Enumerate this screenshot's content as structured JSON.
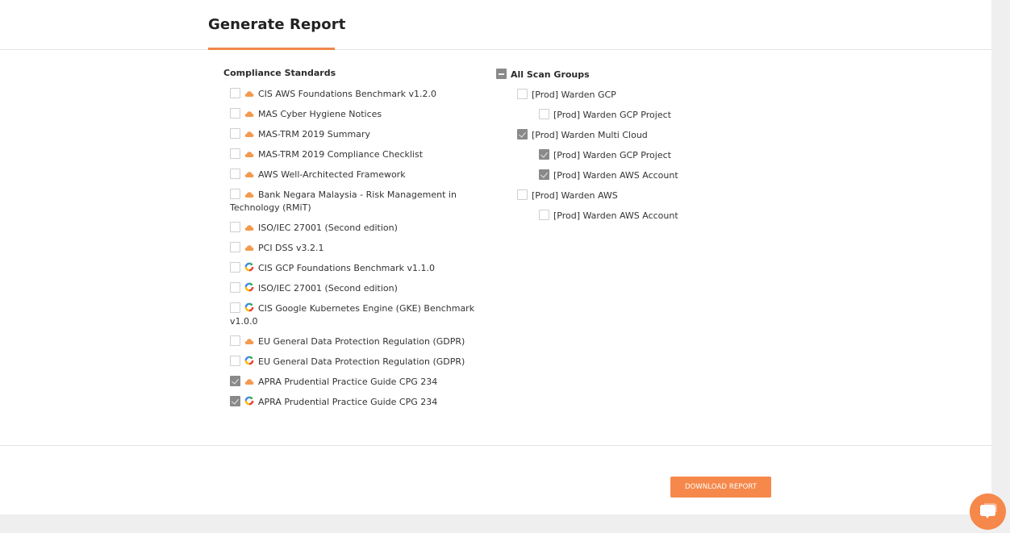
{
  "header": {
    "title": "Generate Report"
  },
  "compliance": {
    "section_title": "Compliance Standards",
    "items": [
      {
        "label": "CIS AWS Foundations Benchmark v1.2.0",
        "provider": "aws",
        "icon": "aws-cloud-icon",
        "checked": false
      },
      {
        "label": "MAS Cyber Hygiene Notices",
        "provider": "aws",
        "icon": "aws-cloud-icon",
        "checked": false
      },
      {
        "label": "MAS-TRM 2019 Summary",
        "provider": "aws",
        "icon": "aws-cloud-icon",
        "checked": false
      },
      {
        "label": "MAS-TRM 2019 Compliance Checklist",
        "provider": "aws",
        "icon": "aws-cloud-icon",
        "checked": false
      },
      {
        "label": "AWS Well-Architected Framework",
        "provider": "aws",
        "icon": "aws-cloud-icon",
        "checked": false
      },
      {
        "label": "Bank Negara Malaysia - Risk Management in Technology (RMiT)",
        "provider": "aws",
        "icon": "aws-cloud-icon",
        "checked": false
      },
      {
        "label": "ISO/IEC 27001 (Second edition)",
        "provider": "aws",
        "icon": "aws-cloud-icon",
        "checked": false
      },
      {
        "label": "PCI DSS v3.2.1",
        "provider": "aws",
        "icon": "aws-cloud-icon",
        "checked": false
      },
      {
        "label": "CIS GCP Foundations Benchmark v1.1.0",
        "provider": "gcp",
        "icon": "gcp-logo-icon",
        "checked": false
      },
      {
        "label": "ISO/IEC 27001 (Second edition)",
        "provider": "gcp",
        "icon": "gcp-logo-icon",
        "checked": false
      },
      {
        "label": "CIS Google Kubernetes Engine (GKE) Benchmark v1.0.0",
        "provider": "gcp",
        "icon": "gcp-logo-icon",
        "checked": false
      },
      {
        "label": "EU General Data Protection Regulation (GDPR)",
        "provider": "aws",
        "icon": "aws-cloud-icon",
        "checked": false
      },
      {
        "label": "EU General Data Protection Regulation (GDPR)",
        "provider": "gcp",
        "icon": "gcp-logo-icon",
        "checked": false
      },
      {
        "label": "APRA Prudential Practice Guide CPG 234",
        "provider": "aws",
        "icon": "aws-cloud-icon",
        "checked": true
      },
      {
        "label": "APRA Prudential Practice Guide CPG 234",
        "provider": "gcp",
        "icon": "gcp-logo-icon",
        "checked": true
      }
    ]
  },
  "scan_groups": {
    "all_label": "All Scan Groups",
    "all_state": "partial",
    "items": [
      {
        "label": "[Prod] Warden GCP",
        "level": 1,
        "checked": false
      },
      {
        "label": "[Prod] Warden GCP Project",
        "level": 2,
        "checked": false
      },
      {
        "label": "[Prod] Warden Multi Cloud",
        "level": 1,
        "checked": true
      },
      {
        "label": "[Prod] Warden GCP Project",
        "level": 2,
        "checked": true
      },
      {
        "label": "[Prod] Warden AWS Account",
        "level": 2,
        "checked": true
      },
      {
        "label": "[Prod] Warden AWS",
        "level": 1,
        "checked": false
      },
      {
        "label": "[Prod] Warden AWS Account",
        "level": 2,
        "checked": false
      }
    ]
  },
  "footer": {
    "download_label": "DOWNLOAD REPORT"
  },
  "chat": {
    "icon": "chat-bubble-icon"
  },
  "colors": {
    "accent": "#f5884a",
    "checked": "#8a8a8a"
  }
}
